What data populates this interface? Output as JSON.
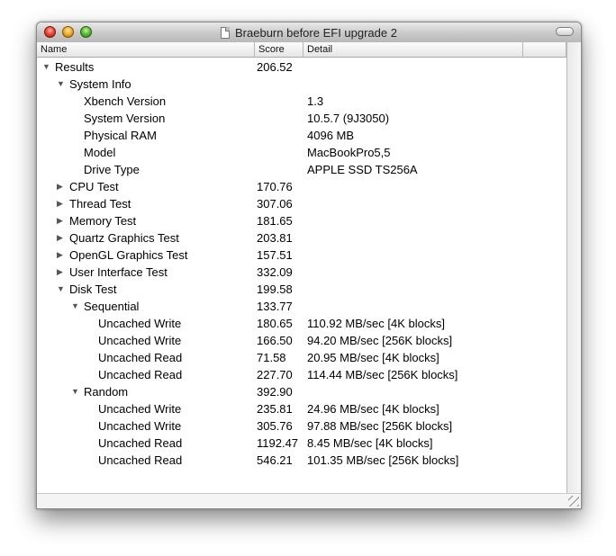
{
  "window": {
    "title": "Braeburn before EFI upgrade 2"
  },
  "columns": {
    "name": "Name",
    "score": "Score",
    "detail": "Detail"
  },
  "rows": [
    {
      "name": "Results",
      "score": "206.52",
      "detail": "",
      "level": 0,
      "disclosure": "open"
    },
    {
      "name": "System Info",
      "score": "",
      "detail": "",
      "level": 1,
      "disclosure": "open"
    },
    {
      "name": "Xbench Version",
      "score": "",
      "detail": "1.3",
      "level": 2,
      "disclosure": "none"
    },
    {
      "name": "System Version",
      "score": "",
      "detail": "10.5.7 (9J3050)",
      "level": 2,
      "disclosure": "none"
    },
    {
      "name": "Physical RAM",
      "score": "",
      "detail": "4096 MB",
      "level": 2,
      "disclosure": "none"
    },
    {
      "name": "Model",
      "score": "",
      "detail": "MacBookPro5,5",
      "level": 2,
      "disclosure": "none"
    },
    {
      "name": "Drive Type",
      "score": "",
      "detail": "APPLE SSD TS256A",
      "level": 2,
      "disclosure": "none"
    },
    {
      "name": "CPU Test",
      "score": "170.76",
      "detail": "",
      "level": 1,
      "disclosure": "closed"
    },
    {
      "name": "Thread Test",
      "score": "307.06",
      "detail": "",
      "level": 1,
      "disclosure": "closed"
    },
    {
      "name": "Memory Test",
      "score": "181.65",
      "detail": "",
      "level": 1,
      "disclosure": "closed"
    },
    {
      "name": "Quartz Graphics Test",
      "score": "203.81",
      "detail": "",
      "level": 1,
      "disclosure": "closed"
    },
    {
      "name": "OpenGL Graphics Test",
      "score": "157.51",
      "detail": "",
      "level": 1,
      "disclosure": "closed"
    },
    {
      "name": "User Interface Test",
      "score": "332.09",
      "detail": "",
      "level": 1,
      "disclosure": "closed"
    },
    {
      "name": "Disk Test",
      "score": "199.58",
      "detail": "",
      "level": 1,
      "disclosure": "open"
    },
    {
      "name": "Sequential",
      "score": "133.77",
      "detail": "",
      "level": 2,
      "disclosure": "open"
    },
    {
      "name": "Uncached Write",
      "score": "180.65",
      "detail": "110.92 MB/sec [4K blocks]",
      "level": 3,
      "disclosure": "none"
    },
    {
      "name": "Uncached Write",
      "score": "166.50",
      "detail": "94.20 MB/sec [256K blocks]",
      "level": 3,
      "disclosure": "none"
    },
    {
      "name": "Uncached Read",
      "score": "71.58",
      "detail": "20.95 MB/sec [4K blocks]",
      "level": 3,
      "disclosure": "none"
    },
    {
      "name": "Uncached Read",
      "score": "227.70",
      "detail": "114.44 MB/sec [256K blocks]",
      "level": 3,
      "disclosure": "none"
    },
    {
      "name": "Random",
      "score": "392.90",
      "detail": "",
      "level": 2,
      "disclosure": "open"
    },
    {
      "name": "Uncached Write",
      "score": "235.81",
      "detail": "24.96 MB/sec [4K blocks]",
      "level": 3,
      "disclosure": "none"
    },
    {
      "name": "Uncached Write",
      "score": "305.76",
      "detail": "97.88 MB/sec [256K blocks]",
      "level": 3,
      "disclosure": "none"
    },
    {
      "name": "Uncached Read",
      "score": "1192.47",
      "detail": "8.45 MB/sec [4K blocks]",
      "level": 3,
      "disclosure": "none"
    },
    {
      "name": "Uncached Read",
      "score": "546.21",
      "detail": "101.35 MB/sec [256K blocks]",
      "level": 3,
      "disclosure": "none"
    }
  ]
}
